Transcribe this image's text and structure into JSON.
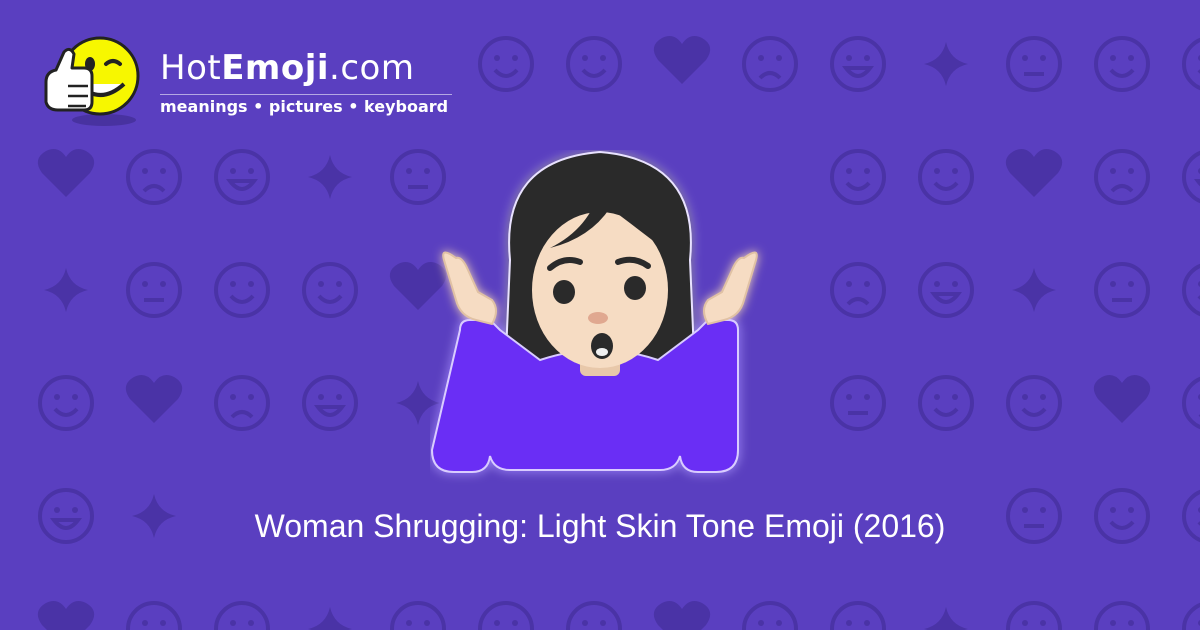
{
  "brand": {
    "name_light": "Hot",
    "name_bold": "Emoji",
    "name_suffix": ".com",
    "tagline": "meanings • pictures • keyboard"
  },
  "caption": "Woman Shrugging: Light Skin Tone Emoji (2016)",
  "colors": {
    "background": "#5a3fc0",
    "pattern": "#4a33a6",
    "shirt": "#6a2df5",
    "skin": "#f6dcc3",
    "hair": "#2b2b2b",
    "mascot": "#f7f700"
  },
  "icons": {
    "logo": "thumbs-up-winking-smiley-icon",
    "hero": "woman-shrugging-light-skin-tone-icon",
    "background": "faint-emoji-pattern"
  }
}
